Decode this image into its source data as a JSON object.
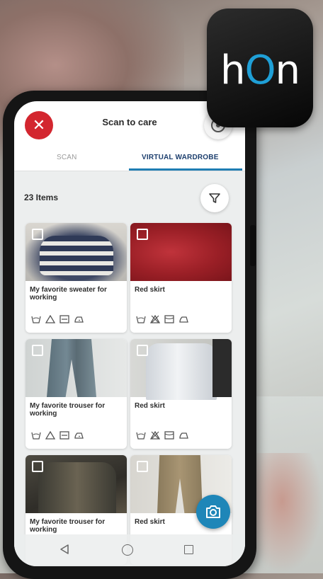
{
  "logo": {
    "brand_h": "h",
    "brand_o": "O",
    "brand_n": "n"
  },
  "app": {
    "title": "Scan to care"
  },
  "tabs": [
    {
      "label": "SCAN",
      "active": false
    },
    {
      "label": "VIRTUAL WARDROBE",
      "active": true
    }
  ],
  "wardrobe": {
    "items_count": "23 Items",
    "cards": [
      {
        "title": "My favorite sweater for working",
        "care_icons": [
          "wash-icon",
          "bleach-icon",
          "dry-icon",
          "iron-icon"
        ]
      },
      {
        "title": "Red skirt",
        "care_icons": [
          "wash-icon",
          "no-bleach-icon",
          "dry-icon",
          "iron-icon"
        ]
      },
      {
        "title": "My favorite trouser for working",
        "care_icons": [
          "wash-icon",
          "bleach-icon",
          "dry-icon",
          "iron-icon"
        ]
      },
      {
        "title": "Red skirt",
        "care_icons": [
          "wash-icon",
          "no-bleach-icon",
          "dry-icon",
          "iron-icon"
        ]
      },
      {
        "title": "My favorite trouser for working",
        "care_icons": []
      },
      {
        "title": "Red skirt",
        "care_icons": []
      }
    ]
  },
  "colors": {
    "accent": "#1f7db3",
    "close": "#d3262f",
    "logo_o": "#1f9fd6"
  }
}
